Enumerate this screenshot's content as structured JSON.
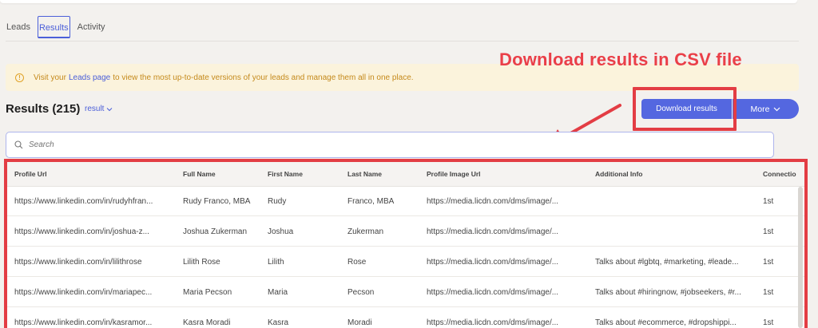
{
  "tabs": [
    {
      "label": "Leads"
    },
    {
      "label": "Results"
    },
    {
      "label": "Activity"
    }
  ],
  "annotation": {
    "title": "Download results in CSV file",
    "color": "#ea3f48"
  },
  "notice": {
    "prefix": "Visit your",
    "link": "Leads page",
    "suffix": "to view the most up-to-date versions of your leads and manage them all in one place.",
    "icon": "warning-icon"
  },
  "results": {
    "title": "Results (215)",
    "selector": "result"
  },
  "buttons": {
    "download": "Download results",
    "more": "More"
  },
  "search": {
    "placeholder": "Search"
  },
  "table": {
    "columns": [
      "Profile Url",
      "Full Name",
      "First Name",
      "Last Name",
      "Profile Image Url",
      "Additional Info",
      "Connectio"
    ],
    "rows": [
      [
        "https://www.linkedin.com/in/rudyhfran...",
        "Rudy Franco, MBA",
        "Rudy",
        "Franco, MBA",
        "https://media.licdn.com/dms/image/...",
        "",
        "1st"
      ],
      [
        "https://www.linkedin.com/in/joshua-z...",
        "Joshua Zukerman",
        "Joshua",
        "Zukerman",
        "https://media.licdn.com/dms/image/...",
        "",
        "1st"
      ],
      [
        "https://www.linkedin.com/in/lilithrose",
        "Lilith Rose",
        "Lilith",
        "Rose",
        "https://media.licdn.com/dms/image/...",
        "Talks about #lgbtq, #marketing, #leade...",
        "1st"
      ],
      [
        "https://www.linkedin.com/in/mariapec...",
        "Maria Pecson",
        "Maria",
        "Pecson",
        "https://media.licdn.com/dms/image/...",
        "Talks about #hiringnow, #jobseekers, #r...",
        "1st"
      ],
      [
        "https://www.linkedin.com/in/kasramor...",
        "Kasra Moradi",
        "Kasra",
        "Moradi",
        "https://media.licdn.com/dms/image/...",
        "Talks about #ecommerce, #dropshippi...",
        "1st"
      ]
    ]
  },
  "colors": {
    "accent": "#5467e0",
    "highlight": "#e33d44",
    "notice_bg": "#fbf3dc"
  }
}
